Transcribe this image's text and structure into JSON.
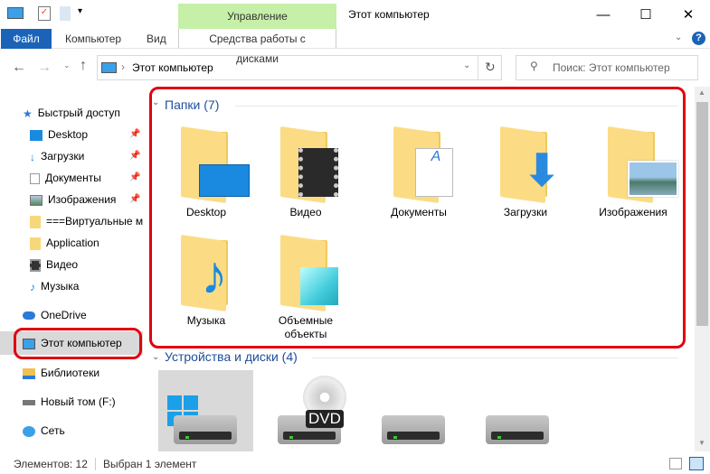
{
  "titlebar": {
    "title": "Этот компьютер",
    "context_tab_group": "Управление"
  },
  "ribbon": {
    "tabs": [
      "Файл",
      "Компьютер",
      "Вид",
      "Средства работы с дисками"
    ]
  },
  "address": {
    "crumbs": [
      "Этот компьютер"
    ]
  },
  "search": {
    "placeholder": "Поиск: Этот компьютер"
  },
  "nav": {
    "quick_access": "Быстрый доступ",
    "items": [
      "Desktop",
      "Загрузки",
      "Документы",
      "Изображения",
      "===Виртуальные машины",
      "Application",
      "Видео",
      "Музыка"
    ],
    "onedrive": "OneDrive",
    "this_pc": "Этот компьютер",
    "libraries": "Библиотеки",
    "volume": "Новый том (F:)",
    "network": "Сеть"
  },
  "content": {
    "folders_header": "Папки (7)",
    "folders": [
      "Desktop",
      "Видео",
      "Документы",
      "Загрузки",
      "Изображения",
      "Музыка",
      "Объемные объекты"
    ],
    "devices_header": "Устройства и диски (4)",
    "dvd_label": "DVD"
  },
  "status": {
    "count": "Элементов: 12",
    "selected": "Выбран 1 элемент"
  },
  "colors": {
    "accent": "#1a63b8",
    "highlight": "#e00010",
    "manage_tab": "#c6efa8"
  }
}
